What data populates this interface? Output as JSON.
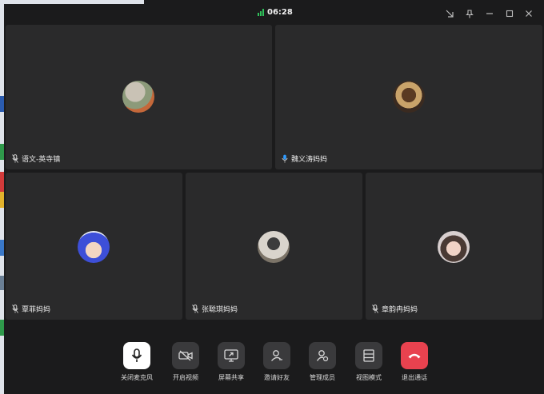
{
  "titlebar": {
    "time": "06:28",
    "signal_color": "#2fc15a"
  },
  "window_controls": [
    "collapse-icon",
    "pin-icon",
    "minimize-icon",
    "maximize-icon",
    "close-icon"
  ],
  "participants": [
    {
      "name": "语文-英寺镇",
      "mic": "muted"
    },
    {
      "name": "魏义涛妈妈",
      "mic": "active"
    },
    {
      "name": "覃菲妈妈",
      "mic": "muted"
    },
    {
      "name": "张聪琪妈妈",
      "mic": "muted"
    },
    {
      "name": "章韵冉妈妈",
      "mic": "muted"
    }
  ],
  "toolbar": {
    "mic_label": "关闭麦克风",
    "camera_label": "开启视频",
    "share_label": "屏幕共享",
    "invite_label": "邀请好友",
    "members_label": "管理成员",
    "layout_label": "视图模式",
    "leave_label": "退出通话"
  },
  "colors": {
    "background": "#1b1b1c",
    "tile": "#2a2a2b",
    "button": "#3a3a3c",
    "leave": "#e8424f",
    "mic_active": "#2f9bff"
  }
}
